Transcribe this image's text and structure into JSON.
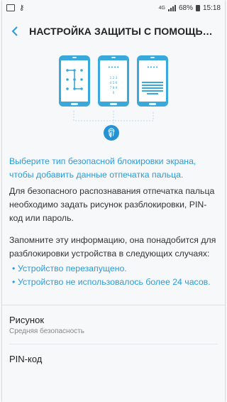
{
  "status_bar": {
    "network_type": "4G",
    "battery": "68%",
    "time": "15:18"
  },
  "header": {
    "title": "НАСТРОЙКА ЗАЩИТЫ С ПОМОЩЬЮ ОТ..."
  },
  "illustration": {
    "pin_mask": "••••",
    "keypad_rows": [
      "1 2 3",
      "4 5 6",
      "7 8 9",
      "0"
    ],
    "icons": [
      "pattern-lock-icon",
      "pin-keypad-icon",
      "password-keyboard-icon",
      "fingerprint-icon"
    ]
  },
  "body": {
    "lead": "Выберите тип безопасной блокировки экрана, чтобы добавить данные отпечатка пальца.",
    "paragraph_1": "Для безопасного распознавания отпечатка пальца необходимо задать рисунок разблокировки, PIN-код или пароль.",
    "paragraph_2": "Запомните эту информацию, она понадобится для разблокировки устройства в следующих случаях:",
    "bullets": [
      "Устройство перезапущено.",
      "Устройство не использовалось более 24 часов."
    ]
  },
  "options": [
    {
      "title": "Рисунок",
      "subtitle": "Средняя безопасность"
    },
    {
      "title": "PIN-код",
      "subtitle": ""
    }
  ],
  "colors": {
    "accent": "#2a9bd8",
    "phone_blue": "#39a9dc",
    "background": "#f7f8fa"
  }
}
